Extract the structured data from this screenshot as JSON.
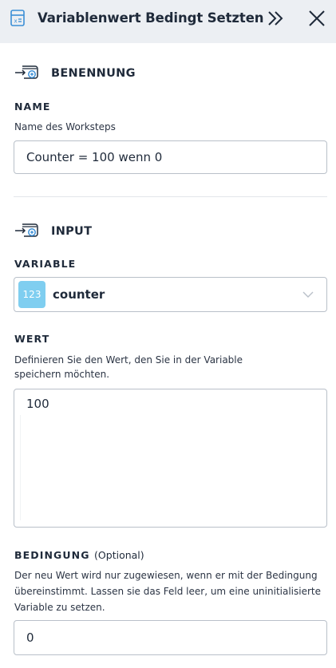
{
  "header": {
    "title": "Variablenwert Bedingt Setzten",
    "icon": "worker-variable-icon",
    "expand_icon": "double-chevron-right-icon",
    "close_icon": "close-icon"
  },
  "section_naming": {
    "title": "BENENNUNG",
    "icon": "transfer-icon",
    "name_label": "NAME",
    "name_description": "Name des Worksteps",
    "name_value": "Counter = 100 wenn 0"
  },
  "section_input": {
    "title": "INPUT",
    "icon": "transfer-icon",
    "variable_label": "VARIABLE",
    "variable_badge": "123",
    "variable_value": "counter",
    "value_label": "WERT",
    "value_description_line1": "Definieren Sie den Wert, den Sie in der Variable",
    "value_description_line2": "speichern möchten.",
    "value_value": "100",
    "condition_label": "BEDINGUNG",
    "condition_optional": "(Optional)",
    "condition_description_line1": "Der neu Wert wird nur zugewiesen, wenn er mit der Bedingung",
    "condition_description_line2": "übereinstimmt. Lassen sie das Feld leer, um eine uninitialisierte",
    "condition_description_line3": "Variable zu setzen.",
    "condition_value": "0"
  },
  "colors": {
    "header_bg": "#eceff3",
    "badge_bg": "#7fcef0",
    "icon_blue": "#3b8fd6",
    "text": "#1f2a3a",
    "border": "#b9c0c9"
  }
}
